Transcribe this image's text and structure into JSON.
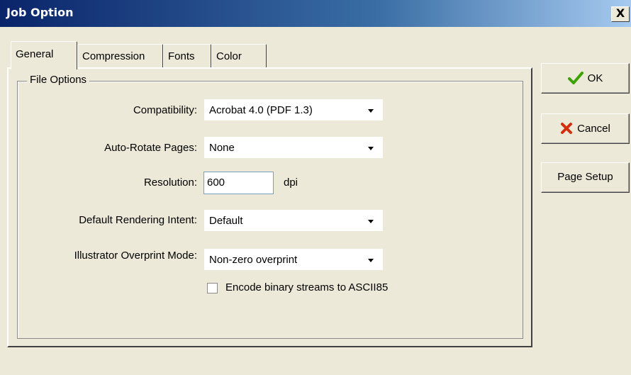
{
  "window": {
    "title": "Job Option",
    "close_glyph": "X"
  },
  "tabs": [
    {
      "label": "General",
      "active": true
    },
    {
      "label": "Compression",
      "active": false
    },
    {
      "label": "Fonts",
      "active": false
    },
    {
      "label": "Color",
      "active": false
    }
  ],
  "group": {
    "label": "File Options"
  },
  "fields": {
    "compatibility": {
      "label": "Compatibility:",
      "value": "Acrobat 4.0 (PDF 1.3)"
    },
    "auto_rotate": {
      "label": "Auto-Rotate Pages:",
      "value": "None"
    },
    "resolution": {
      "label": "Resolution:",
      "value": "600",
      "unit": "dpi"
    },
    "rendering_intent": {
      "label": "Default Rendering Intent:",
      "value": "Default"
    },
    "overprint_mode": {
      "label": "Illustrator Overprint Mode:",
      "value": "Non-zero overprint"
    },
    "encode_ascii85": {
      "label": "Encode binary streams to ASCII85",
      "checked": false
    }
  },
  "buttons": {
    "ok": {
      "label": "OK",
      "icon": "check-icon",
      "color": "#3aa300"
    },
    "cancel": {
      "label": "Cancel",
      "icon": "x-icon",
      "color": "#d03010"
    },
    "page_setup": {
      "label": "Page Setup"
    }
  }
}
